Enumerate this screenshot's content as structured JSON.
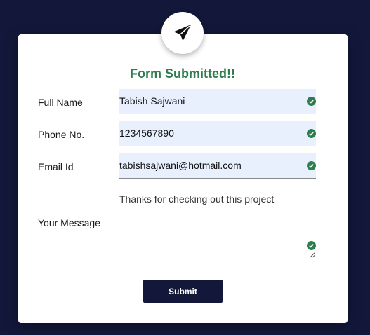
{
  "form": {
    "title": "Form Submitted!!",
    "fields": [
      {
        "label": "Full Name",
        "value": "Tabish Sajwani"
      },
      {
        "label": "Phone No.",
        "value": "1234567890"
      },
      {
        "label": "Email Id",
        "value": "tabishsajwani@hotmail.com"
      }
    ],
    "message": {
      "label": "Your Message",
      "value": "Thanks for checking out this project"
    },
    "submit_label": "Submit"
  },
  "colors": {
    "background": "#13183a",
    "success": "#2e7d4f",
    "field_fill": "#e8f0fe",
    "button": "#13183a"
  },
  "icons": {
    "badge": "paper-plane-icon",
    "valid": "check-circle-icon"
  }
}
